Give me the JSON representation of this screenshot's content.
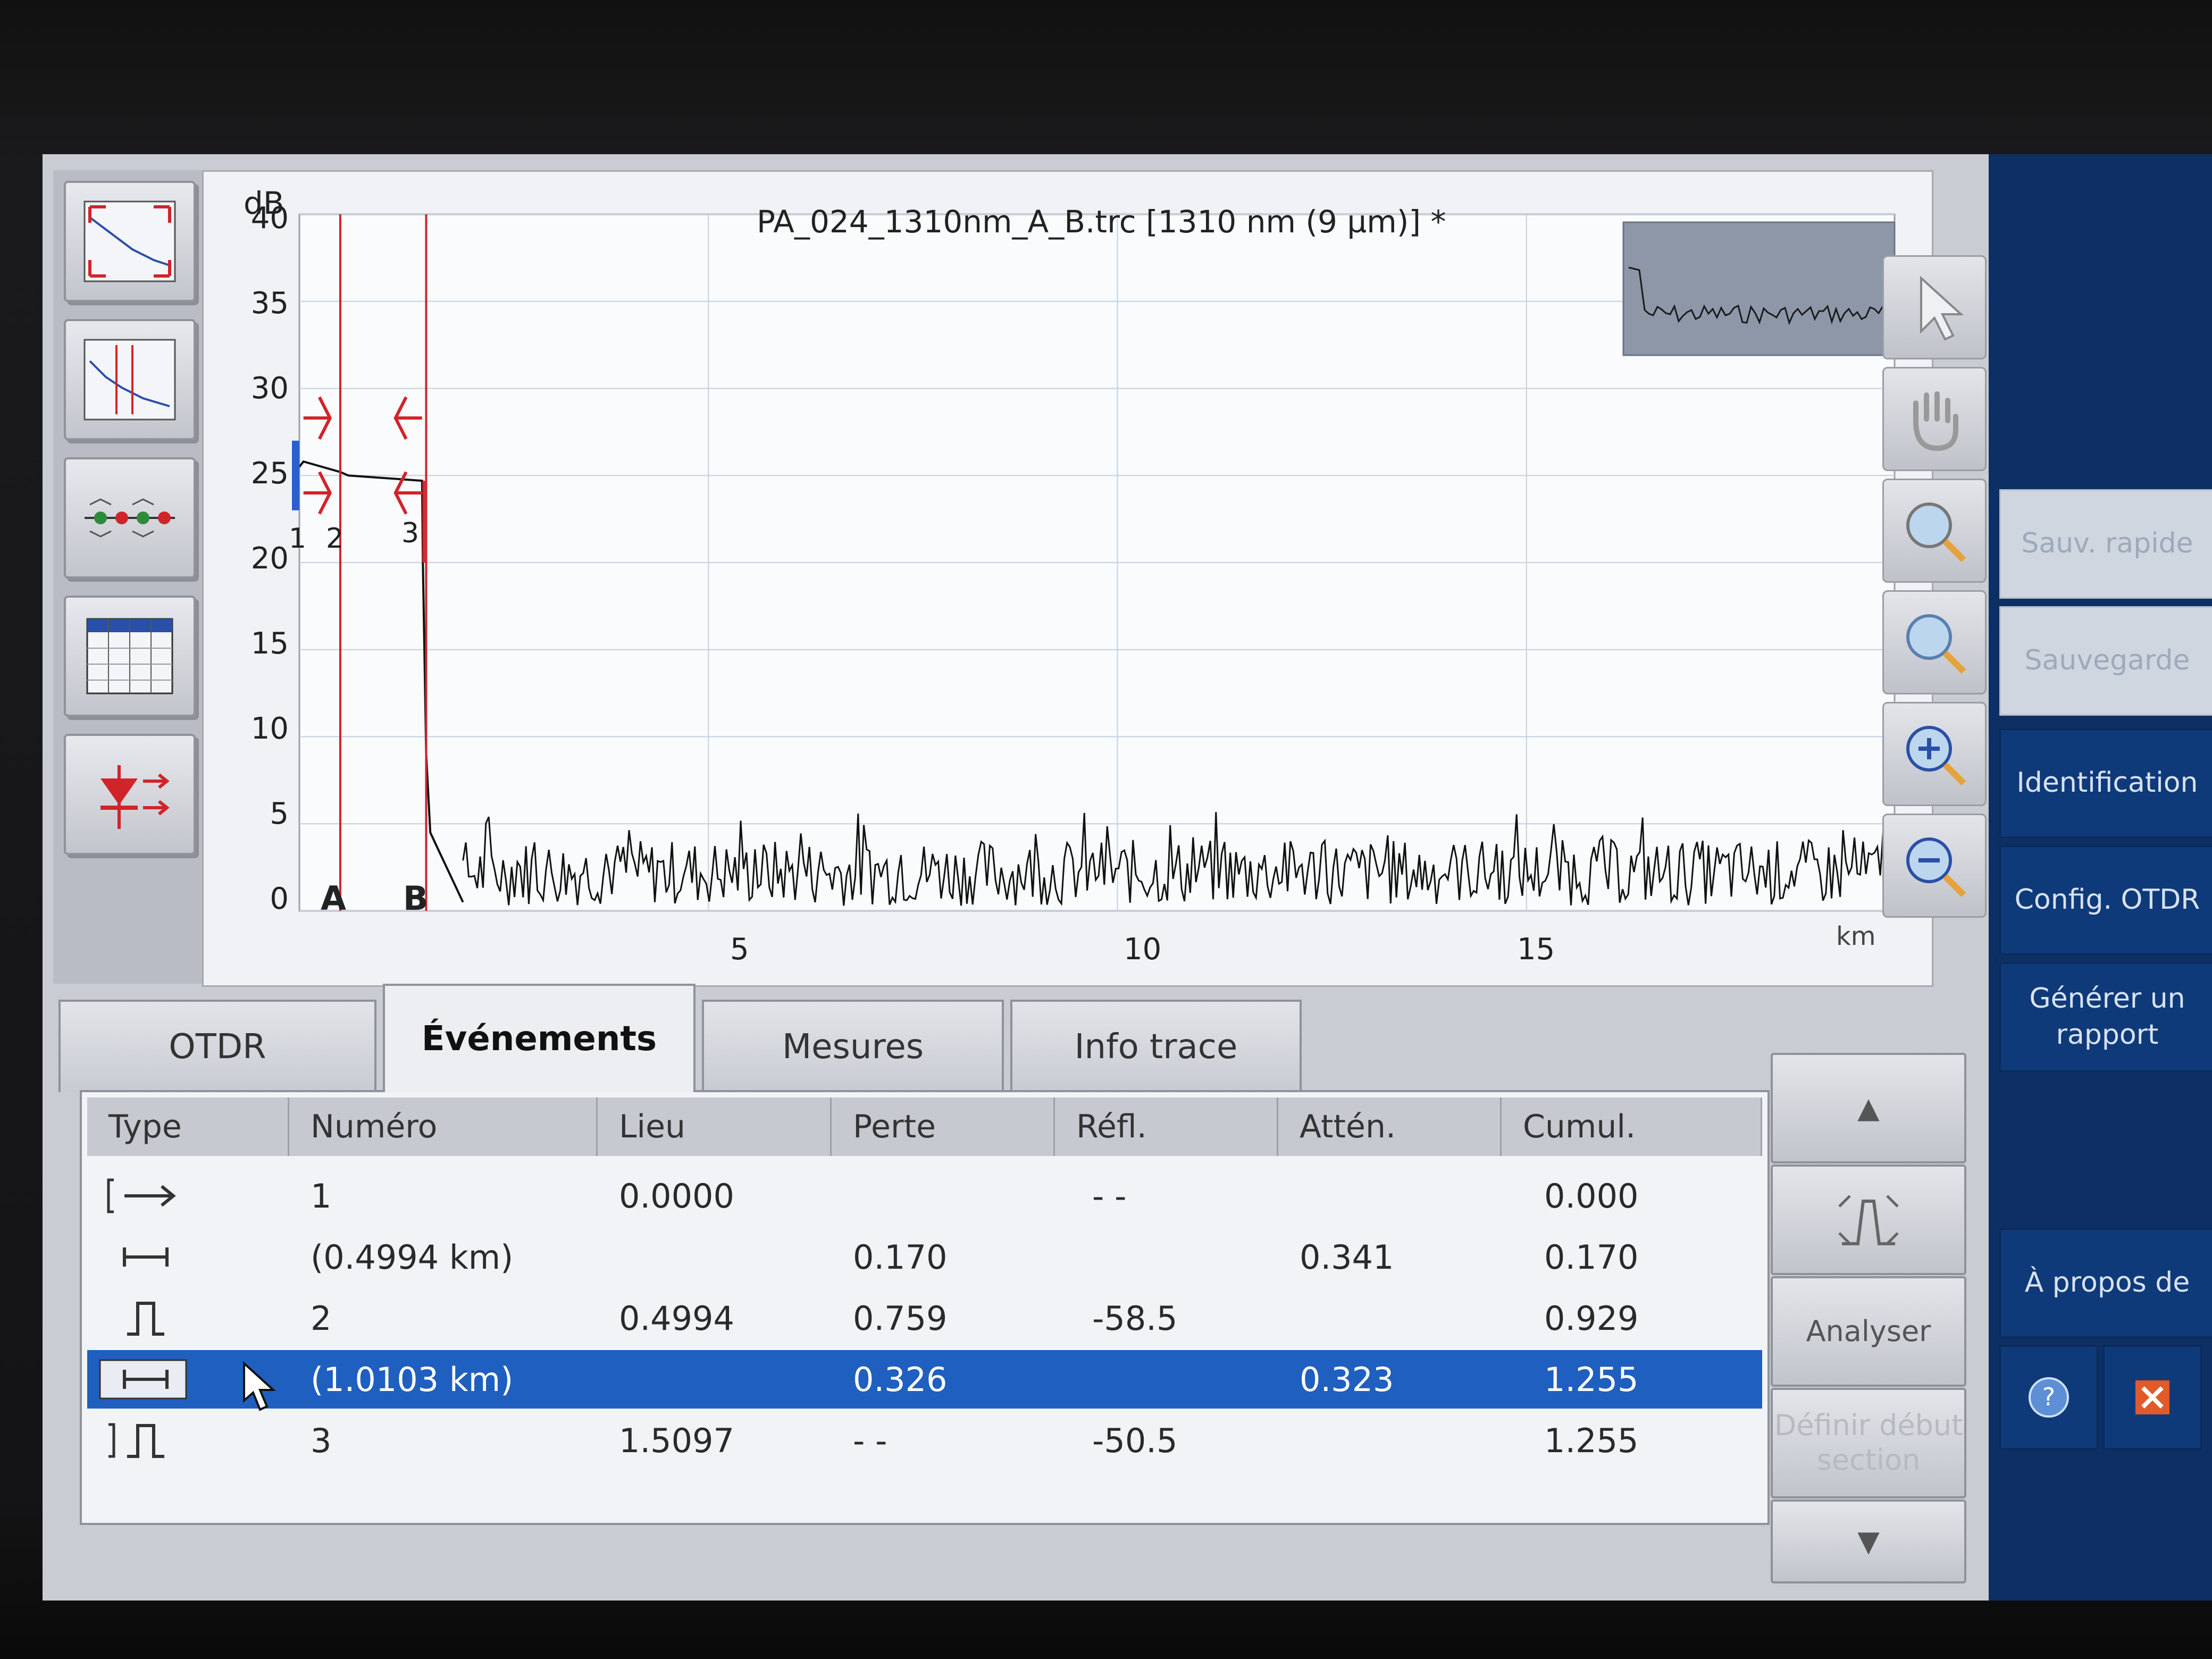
{
  "graph": {
    "title": "PA_024_1310nm_A_B.trc [1310 nm (9 µm)] *",
    "y_unit": "dB",
    "x_unit": "km",
    "y_ticks": [
      "40",
      "35",
      "30",
      "25",
      "20",
      "15",
      "10",
      "5",
      "0"
    ],
    "x_ticks": [
      "5",
      "10",
      "15"
    ],
    "markers": [
      "A",
      "B"
    ],
    "event_labels": [
      "1",
      "2",
      "3"
    ]
  },
  "chart_data": {
    "type": "line",
    "title": "PA_024_1310nm_A_B.trc [1310 nm (9 µm)] *",
    "xlabel": "km",
    "ylabel": "dB",
    "xlim": [
      0,
      19.5
    ],
    "ylim": [
      0,
      40
    ],
    "grid": true,
    "series": [
      {
        "x": [
          0.0,
          0.05,
          0.5,
          0.6,
          1.5,
          1.51,
          1.55,
          1.6,
          1.7,
          2.0
        ],
        "y": [
          25.5,
          25.8,
          25.2,
          25.0,
          24.7,
          20.0,
          9.0,
          4.5,
          3.5,
          0.5
        ]
      }
    ],
    "cursors": [
      {
        "label": "A",
        "x": 0.5
      },
      {
        "label": "B",
        "x": 1.55
      }
    ]
  },
  "tabs": [
    "OTDR",
    "Événements",
    "Mesures",
    "Info trace"
  ],
  "active_tab": "Événements",
  "table": {
    "columns": [
      "Type",
      "Numéro",
      "Lieu",
      "Perte",
      "Réfl.",
      "Attén.",
      "Cumul."
    ],
    "rows": [
      {
        "type_icon": "launch-event-icon",
        "numero": "1",
        "lieu": "0.0000",
        "perte": "",
        "refl": "- -",
        "atten": "",
        "cumul": "0.000"
      },
      {
        "type_icon": "fiber-section-icon",
        "numero": "(0.4994 km)",
        "lieu": "",
        "perte": "0.170",
        "refl": "",
        "atten": "0.341",
        "cumul": "0.170"
      },
      {
        "type_icon": "reflective-event-icon",
        "numero": "2",
        "lieu": "0.4994",
        "perte": "0.759",
        "refl": "-58.5",
        "atten": "",
        "cumul": "0.929"
      },
      {
        "type_icon": "fiber-section-icon",
        "numero": "(1.0103 km)",
        "lieu": "",
        "perte": "0.326",
        "refl": "",
        "atten": "0.323",
        "cumul": "1.255"
      },
      {
        "type_icon": "end-reflective-event-icon",
        "numero": "3",
        "lieu": "1.5097",
        "perte": "- -",
        "refl": "-50.5",
        "atten": "",
        "cumul": "1.255"
      }
    ],
    "selected_row": 3
  },
  "table_buttons": {
    "up": "▲",
    "analyze": "Analyser",
    "set_section_start": "Définir début section",
    "down": "▼"
  },
  "side_menu": {
    "save_as": "Sauv. rapide",
    "save": "Sauvegarde",
    "identification": "Identification",
    "config": "Config. OTDR",
    "report": "Générer un rapport",
    "about": "À propos de"
  },
  "colors": {
    "selection": "#1f5fbf",
    "marker_red": "#d0242a",
    "menu_blue": "#0d2f63",
    "trace": "#111111"
  }
}
